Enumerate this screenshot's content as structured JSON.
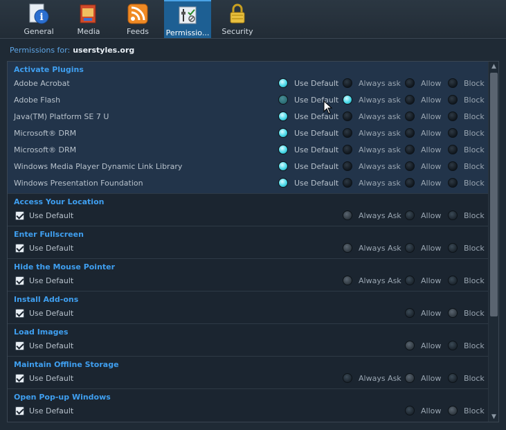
{
  "tabs": [
    {
      "label": "General",
      "icon": "info-icon"
    },
    {
      "label": "Media",
      "icon": "media-icon"
    },
    {
      "label": "Feeds",
      "icon": "rss-icon"
    },
    {
      "label": "Permissio...",
      "icon": "permissions-icon",
      "selected": true
    },
    {
      "label": "Security",
      "icon": "lock-icon"
    }
  ],
  "permissions_for": {
    "label": "Permissions for:",
    "site": "userstyles.org"
  },
  "plugins": {
    "title": "Activate Plugins",
    "options": [
      "Use Default",
      "Always ask",
      "Allow",
      "Block"
    ],
    "rows": [
      {
        "name": "Adobe Acrobat",
        "selected": "Use Default"
      },
      {
        "name": "Adobe Flash",
        "selected": "Always ask"
      },
      {
        "name": "Java(TM) Platform SE 7 U",
        "selected": "Use Default"
      },
      {
        "name": "Microsoft® DRM",
        "selected": "Use Default"
      },
      {
        "name": "Microsoft® DRM",
        "selected": "Use Default"
      },
      {
        "name": "Windows Media Player  Dynamic Link Library",
        "selected": "Use Default"
      },
      {
        "name": "Windows Presentation Foundation",
        "selected": "Use Default"
      }
    ]
  },
  "sections": [
    {
      "title": "Access Your Location",
      "use_default": "Use Default",
      "options": [
        "Always Ask",
        "Allow",
        "Block"
      ],
      "current": "Always Ask"
    },
    {
      "title": "Enter Fullscreen",
      "use_default": "Use Default",
      "options": [
        "Always Ask",
        "Allow",
        "Block"
      ],
      "current": "Always Ask"
    },
    {
      "title": "Hide the Mouse Pointer",
      "use_default": "Use Default",
      "options": [
        "Always Ask",
        "Allow",
        "Block"
      ],
      "current": "Always Ask"
    },
    {
      "title": "Install Add-ons",
      "use_default": "Use Default",
      "options": [
        "Allow",
        "Block"
      ],
      "current": "Block"
    },
    {
      "title": "Load Images",
      "use_default": "Use Default",
      "options": [
        "Allow",
        "Block"
      ],
      "current": "Allow"
    },
    {
      "title": "Maintain Offline Storage",
      "use_default": "Use Default",
      "options": [
        "Always Ask",
        "Allow",
        "Block"
      ],
      "current": "Allow"
    },
    {
      "title": "Open Pop-up Windows",
      "use_default": "Use Default",
      "options": [
        "Allow",
        "Block"
      ],
      "current": "Block"
    }
  ],
  "colors": {
    "accent": "#3f9ff0",
    "selected_tab": "#1d5f93",
    "radio_on": "#48d8e8"
  }
}
